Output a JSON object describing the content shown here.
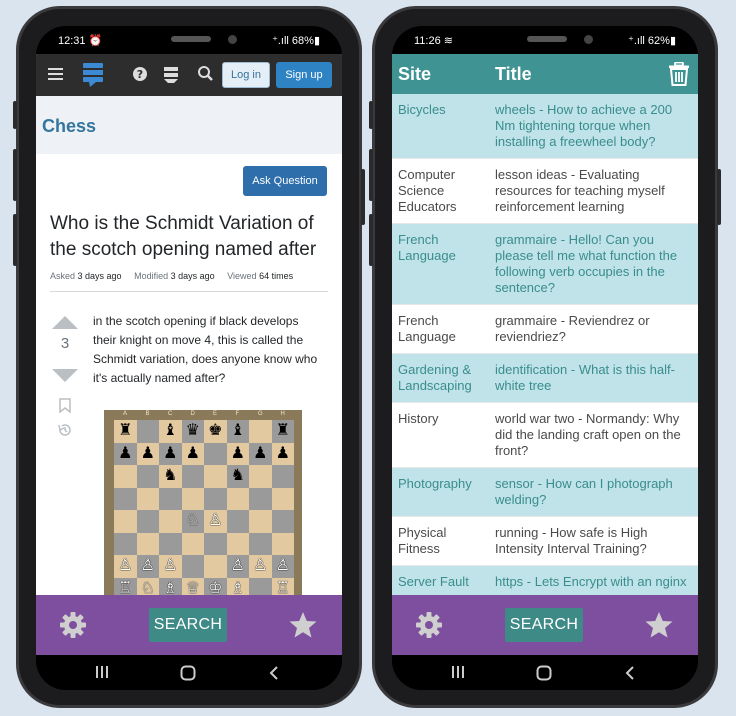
{
  "left_phone": {
    "status": {
      "time": "12:31 ⏰",
      "right": "⁺.ıll 68%▮"
    },
    "topbar": {
      "login_label": "Log in",
      "signup_label": "Sign up"
    },
    "site_name": "Chess",
    "ask_button": "Ask Question",
    "question": {
      "title": "Who is the Schmidt Variation of the scotch opening named after",
      "asked_label": "Asked",
      "asked_value": "3 days ago",
      "modified_label": "Modified",
      "modified_value": "3 days ago",
      "viewed_label": "Viewed",
      "viewed_value": "64 times",
      "votes": "3",
      "body": "in the scotch opening if black develops their knight on move 4, this is called the Schmidt variation, does anyone know who it's actually named after?"
    },
    "board": {
      "files": [
        "A",
        "B",
        "C",
        "D",
        "E",
        "F",
        "G",
        "H"
      ],
      "ranks": [
        [
          "b:♜",
          "",
          "b:♝",
          "b:♛",
          "b:♚",
          "b:♝",
          "",
          "b:♜"
        ],
        [
          "b:♟",
          "b:♟",
          "b:♟",
          "b:♟",
          "",
          "b:♟",
          "b:♟",
          "b:♟"
        ],
        [
          "",
          "",
          "b:♞",
          "",
          "",
          "b:♞",
          "",
          ""
        ],
        [
          "",
          "",
          "",
          "",
          "",
          "",
          "",
          ""
        ],
        [
          "",
          "",
          "",
          "w:♘",
          "w:♙",
          "",
          "",
          ""
        ],
        [
          "",
          "",
          "",
          "",
          "",
          "",
          "",
          ""
        ],
        [
          "w:♙",
          "w:♙",
          "w:♙",
          "",
          "",
          "w:♙",
          "w:♙",
          "w:♙"
        ],
        [
          "w:♖",
          "w:♘",
          "w:♗",
          "w:♕",
          "w:♔",
          "w:♗",
          "",
          "w:♖"
        ]
      ]
    },
    "bottom_bar": {
      "search_label": "SEARCH"
    }
  },
  "right_phone": {
    "status": {
      "time": "11:26 ≋",
      "right": "⁺.ıll 62%▮"
    },
    "header": {
      "site": "Site",
      "title": "Title"
    },
    "rows": [
      {
        "site": "Bicycles",
        "title": "wheels - How to achieve a 200 Nm tightening torque when installing a freewheel body?"
      },
      {
        "site": "Computer Science Educators",
        "title": "lesson ideas - Evaluating resources for teaching myself reinforcement learning"
      },
      {
        "site": "French Language",
        "title": "grammaire - Hello! Can you please tell me what function the following verb occupies in the sentence?"
      },
      {
        "site": "French Language",
        "title": "grammaire - Reviendrez or reviendriez?"
      },
      {
        "site": "Gardening & Landscaping",
        "title": "identification - What is this half-white tree"
      },
      {
        "site": "History",
        "title": "world war two - Normandy: Why did the landing craft open on the front?"
      },
      {
        "site": "Photography",
        "title": "sensor - How can I photograph welding?"
      },
      {
        "site": "Physical Fitness",
        "title": "running - How safe is High Intensity Interval Training?"
      },
      {
        "site": "Server Fault",
        "title": "https - Lets Encrypt with an nginx reverse proxy"
      }
    ],
    "bottom_bar": {
      "search_label": "SEARCH"
    }
  },
  "colors": {
    "table_header": "#3f9393",
    "table_alt_row": "#bfe3e8",
    "bottom_bar": "#7e4f9e",
    "search_button": "#3e8a86",
    "signup_button": "#2d83c4"
  },
  "icons": {
    "left_topbar": [
      "hamburger-menu-icon",
      "stack-exchange-logo-icon",
      "help-icon",
      "inbox-icon",
      "search-icon"
    ],
    "bottom_bar": [
      "gear-icon",
      "star-icon"
    ],
    "right_header": [
      "trash-icon"
    ],
    "navbar": [
      "recent-apps-icon",
      "home-icon",
      "back-icon"
    ]
  }
}
